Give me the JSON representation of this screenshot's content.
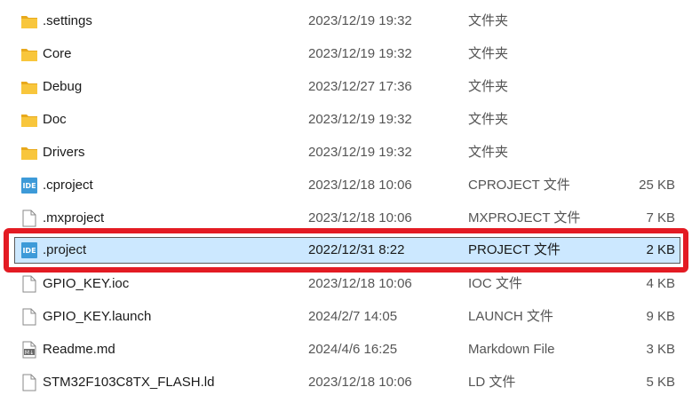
{
  "files": [
    {
      "name": ".settings",
      "date": "2023/12/19 19:32",
      "type": "文件夹",
      "size": "",
      "icon": "folder-icon"
    },
    {
      "name": "Core",
      "date": "2023/12/19 19:32",
      "type": "文件夹",
      "size": "",
      "icon": "folder-icon"
    },
    {
      "name": "Debug",
      "date": "2023/12/27 17:36",
      "type": "文件夹",
      "size": "",
      "icon": "folder-icon"
    },
    {
      "name": "Doc",
      "date": "2023/12/19 19:32",
      "type": "文件夹",
      "size": "",
      "icon": "folder-icon"
    },
    {
      "name": "Drivers",
      "date": "2023/12/19 19:32",
      "type": "文件夹",
      "size": "",
      "icon": "folder-icon"
    },
    {
      "name": ".cproject",
      "date": "2023/12/18 10:06",
      "type": "CPROJECT 文件",
      "size": "25 KB",
      "icon": "ide-icon"
    },
    {
      "name": ".mxproject",
      "date": "2023/12/18 10:06",
      "type": "MXPROJECT 文件",
      "size": "7 KB",
      "icon": "document-icon"
    },
    {
      "name": ".project",
      "date": "2022/12/31 8:22",
      "type": "PROJECT 文件",
      "size": "2 KB",
      "icon": "ide-icon"
    },
    {
      "name": "GPIO_KEY.ioc",
      "date": "2023/12/18 10:06",
      "type": "IOC 文件",
      "size": "4 KB",
      "icon": "document-icon"
    },
    {
      "name": "GPIO_KEY.launch",
      "date": "2024/2/7 14:05",
      "type": "LAUNCH 文件",
      "size": "9 KB",
      "icon": "document-icon"
    },
    {
      "name": "Readme.md",
      "date": "2024/4/6 16:25",
      "type": "Markdown File",
      "size": "3 KB",
      "icon": "markdown-icon"
    },
    {
      "name": "STM32F103C8TX_FLASH.ld",
      "date": "2023/12/18 10:06",
      "type": "LD 文件",
      "size": "5 KB",
      "icon": "document-icon"
    }
  ],
  "ide_badge_text": "IDE",
  "markdown_badge_text": "M↓",
  "colors": {
    "selection_bg": "#cce8ff",
    "highlight_border": "#e31b23",
    "folder_yellow": "#f8c63c",
    "ide_blue": "#3d9ad8"
  }
}
